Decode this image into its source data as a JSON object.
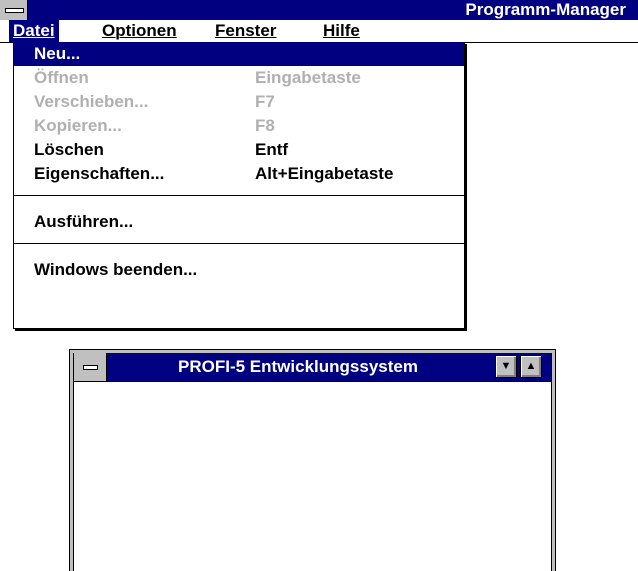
{
  "main_window": {
    "title": "Programm-Manager",
    "menu": [
      {
        "label": "Datei"
      },
      {
        "label": "Optionen"
      },
      {
        "label": "Fenster"
      },
      {
        "label": "Hilfe"
      }
    ]
  },
  "file_menu": {
    "items": [
      {
        "label": "Neu...",
        "accel": "",
        "state": "selected"
      },
      {
        "label": "Öffnen",
        "accel": "Eingabetaste",
        "state": "disabled"
      },
      {
        "label": "Verschieben...",
        "accel": "F7",
        "state": "disabled"
      },
      {
        "label": "Kopieren...",
        "accel": "F8",
        "state": "disabled"
      },
      {
        "label": "Löschen",
        "accel": "Entf",
        "state": "enabled"
      },
      {
        "label": "Eigenschaften...",
        "accel": "Alt+Eingabetaste",
        "state": "enabled"
      },
      {
        "label": "Ausführen...",
        "accel": "",
        "state": "enabled"
      },
      {
        "label": "Windows beenden...",
        "accel": "",
        "state": "enabled"
      }
    ]
  },
  "child_window": {
    "title": "PROFI-5 Entwicklungssystem",
    "minimize_icon": "triangle-down",
    "maximize_icon": "triangle-up"
  },
  "colors": {
    "title_bar": "#000080",
    "selection": "#000080",
    "disabled_text": "#b0b0b0",
    "chrome": "#c0c0c0"
  }
}
